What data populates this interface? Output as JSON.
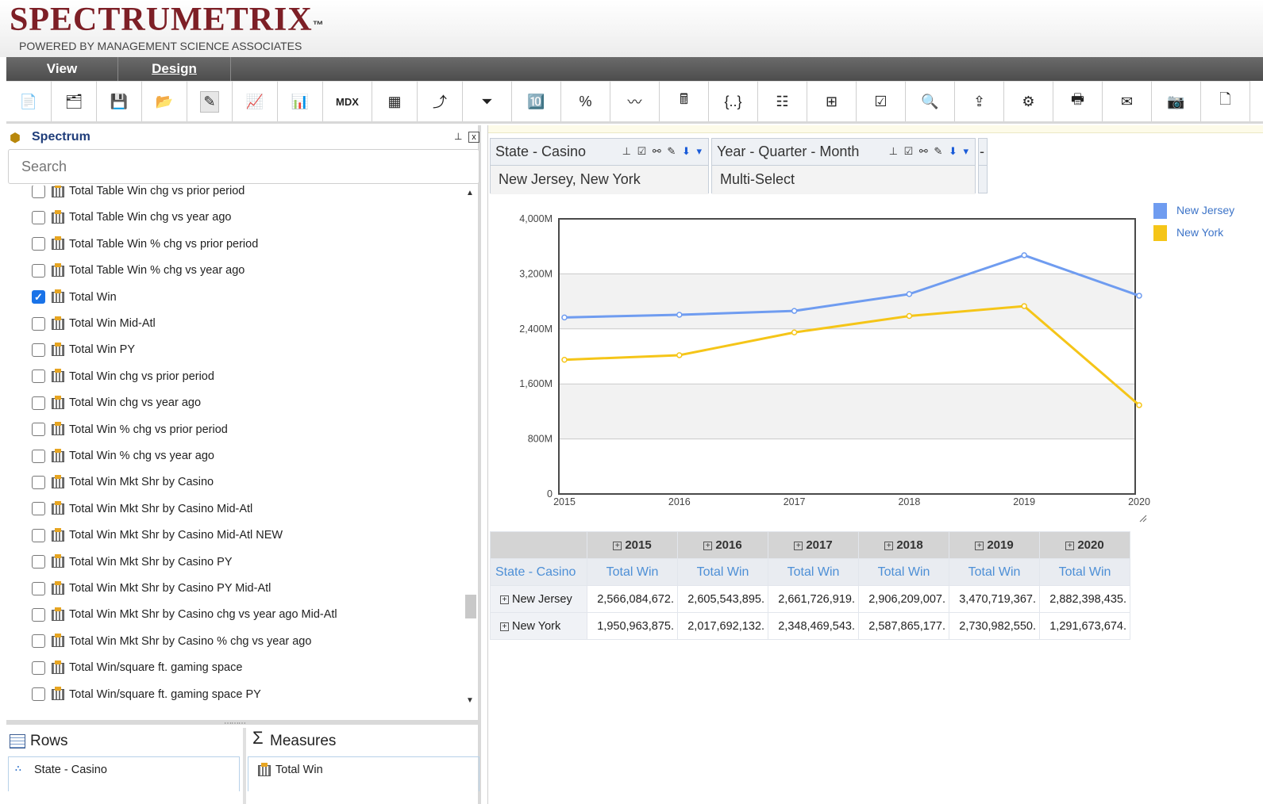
{
  "app": {
    "logo": "SPECTRUMETRIX",
    "trademark": "™",
    "tagline": "POWERED BY MANAGEMENT SCIENCE ASSOCIATES"
  },
  "menu": {
    "view": "View",
    "design": "Design"
  },
  "toolbar": {
    "mdx_label": "MDX",
    "buttons": [
      "new-report-icon",
      "open-cube-icon",
      "save-icon",
      "open-folder-icon",
      "edit-icon",
      "chart-icon",
      "bar-chart-icon",
      "mdx",
      "pivot-table-icon",
      "drill-icon",
      "filter-icon",
      "top-n-icon",
      "percent-icon",
      "trend-icon",
      "calculator-icon",
      "formula-icon",
      "grid-icon",
      "column-chooser-icon",
      "checkbox-icon",
      "zoom-icon",
      "export-icon",
      "settings-icon",
      "print-icon",
      "mail-icon",
      "camera-icon",
      "document-icon"
    ]
  },
  "spectrum": {
    "title": "Spectrum",
    "pin": "⊥",
    "close": "x",
    "search_placeholder": "Search",
    "items": [
      {
        "label": "Total Table Win chg vs prior period",
        "checked": false
      },
      {
        "label": "Total Table Win chg vs year ago",
        "checked": false
      },
      {
        "label": "Total Table Win % chg vs prior period",
        "checked": false
      },
      {
        "label": "Total Table Win % chg vs year ago",
        "checked": false
      },
      {
        "label": "Total Win",
        "checked": true
      },
      {
        "label": "Total Win Mid-Atl",
        "checked": false
      },
      {
        "label": "Total Win PY",
        "checked": false
      },
      {
        "label": "Total Win chg vs prior period",
        "checked": false
      },
      {
        "label": "Total Win chg vs year ago",
        "checked": false
      },
      {
        "label": "Total Win % chg vs prior period",
        "checked": false
      },
      {
        "label": "Total Win % chg vs year ago",
        "checked": false
      },
      {
        "label": "Total Win Mkt Shr by Casino",
        "checked": false
      },
      {
        "label": "Total Win Mkt Shr by Casino Mid-Atl",
        "checked": false
      },
      {
        "label": "Total Win Mkt Shr by Casino Mid-Atl NEW",
        "checked": false
      },
      {
        "label": "Total Win Mkt Shr by Casino PY",
        "checked": false
      },
      {
        "label": "Total Win Mkt Shr by Casino PY Mid-Atl",
        "checked": false
      },
      {
        "label": "Total Win Mkt Shr by Casino chg vs year ago Mid-Atl",
        "checked": false
      },
      {
        "label": "Total Win Mkt Shr by Casino % chg vs year ago",
        "checked": false
      },
      {
        "label": "Total Win/square ft. gaming space",
        "checked": false
      },
      {
        "label": "Total Win/square ft. gaming space PY",
        "checked": false
      }
    ]
  },
  "rows_panel": {
    "title": "Rows",
    "item": "State - Casino"
  },
  "measures_panel": {
    "title": "Measures",
    "sigma": "Σ",
    "item": "Total Win"
  },
  "filters": [
    {
      "title": "State - Casino",
      "value": "New Jersey, New York"
    },
    {
      "title": "Year - Quarter - Month",
      "value": "Multi-Select"
    },
    {
      "title": "-",
      "value": ""
    }
  ],
  "colors": {
    "new_jersey": "#6f9cf0",
    "new_york": "#f5c518",
    "logo": "#7d1f26"
  },
  "chart_data": {
    "type": "line",
    "x": [
      "2015",
      "2016",
      "2017",
      "2018",
      "2019",
      "2020"
    ],
    "yticks": [
      "0",
      "800M",
      "1,600M",
      "2,400M",
      "3,200M",
      "4,000M"
    ],
    "ylim": [
      0,
      4000
    ],
    "series": [
      {
        "name": "New Jersey",
        "color": "#6f9cf0",
        "values": [
          2566.08,
          2605.54,
          2661.73,
          2906.21,
          3470.72,
          2882.4
        ]
      },
      {
        "name": "New York",
        "color": "#f5c518",
        "values": [
          1950.96,
          2017.69,
          2348.47,
          2587.87,
          2730.98,
          1291.67
        ]
      }
    ],
    "legend_position": "top-right",
    "grid": true
  },
  "pivot": {
    "years": [
      "2015",
      "2016",
      "2017",
      "2018",
      "2019",
      "2020"
    ],
    "row_header": "State - Casino",
    "measure": "Total Win",
    "rows": [
      {
        "label": "New Jersey",
        "values": [
          "2,566,084,672.",
          "2,605,543,895.",
          "2,661,726,919.",
          "2,906,209,007.",
          "3,470,719,367.",
          "2,882,398,435."
        ]
      },
      {
        "label": "New York",
        "values": [
          "1,950,963,875.",
          "2,017,692,132.",
          "2,348,469,543.",
          "2,587,865,177.",
          "2,730,982,550.",
          "1,291,673,674."
        ]
      }
    ]
  }
}
